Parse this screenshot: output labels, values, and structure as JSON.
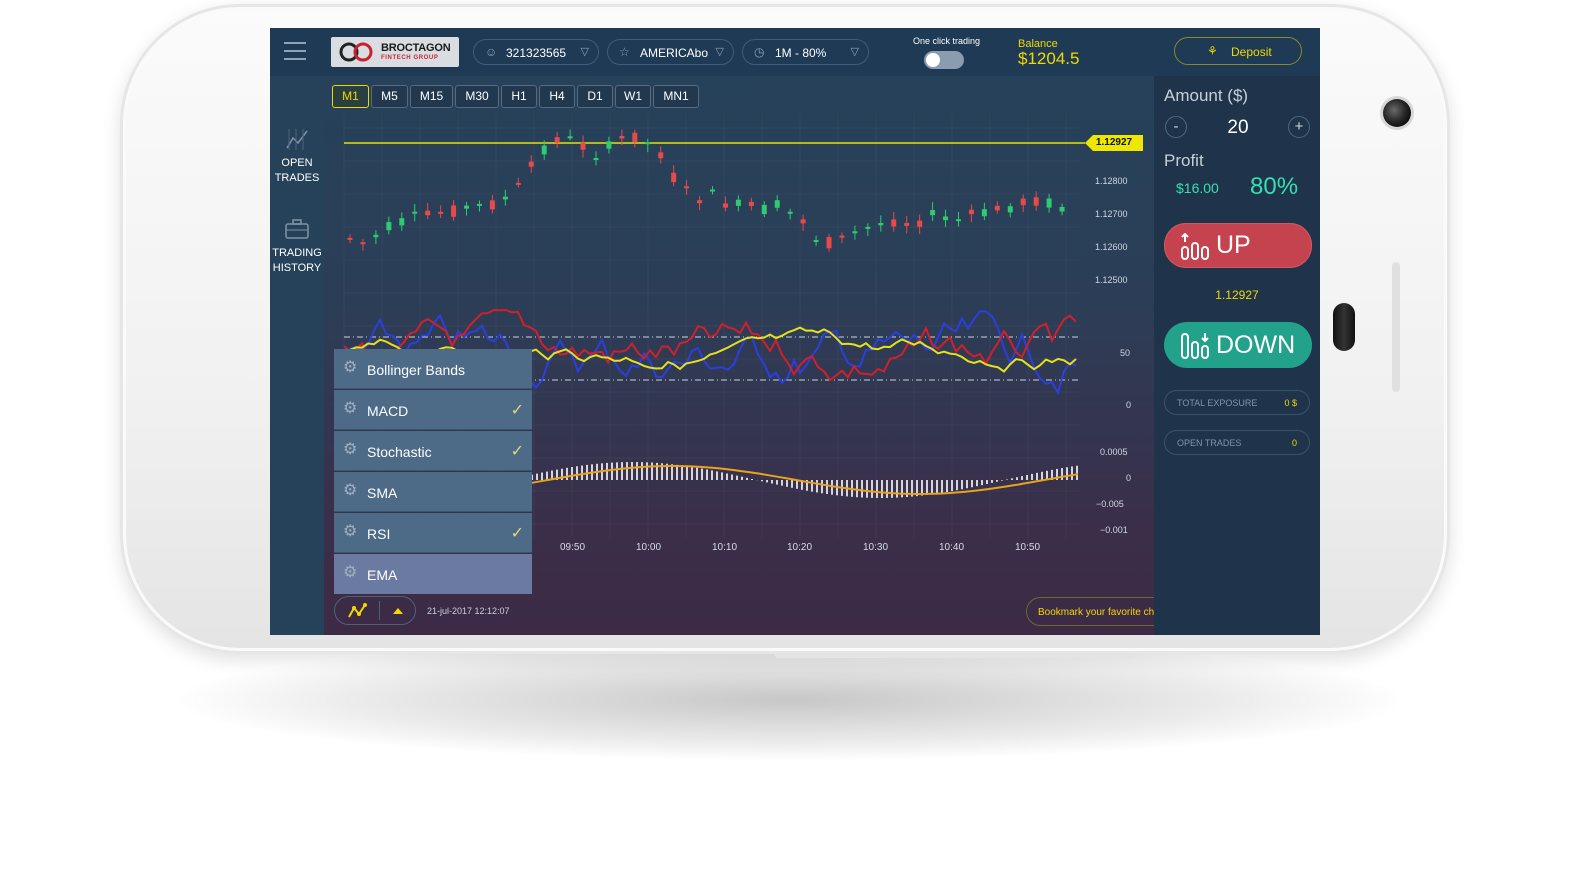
{
  "topbar": {
    "logo": {
      "name": "BROCTAGON",
      "sub": "FINTECH GROUP"
    },
    "account": {
      "icon": "user-icon",
      "value": "321323565"
    },
    "asset": {
      "icon": "star-icon",
      "value": "AMERICAbo"
    },
    "expiry": {
      "icon": "clock-icon",
      "value": "1M - 80%"
    },
    "one_click": {
      "label": "One click trading",
      "enabled": false
    },
    "balance": {
      "label": "Balance",
      "value": "$1204.5"
    },
    "deposit": {
      "label": "Deposit",
      "icon": "money-bag-icon"
    }
  },
  "leftnav": {
    "items": [
      {
        "label_line1": "OPEN",
        "label_line2": "TRADES",
        "icon": "chart-icon"
      },
      {
        "label_line1": "TRADING",
        "label_line2": "HISTORY",
        "icon": "briefcase-icon"
      }
    ]
  },
  "timeframes": [
    {
      "label": "M1",
      "active": true
    },
    {
      "label": "M5",
      "active": false
    },
    {
      "label": "M15",
      "active": false
    },
    {
      "label": "M30",
      "active": false
    },
    {
      "label": "H1",
      "active": false
    },
    {
      "label": "H4",
      "active": false
    },
    {
      "label": "D1",
      "active": false
    },
    {
      "label": "W1",
      "active": false
    },
    {
      "label": "MN1",
      "active": false
    }
  ],
  "chart": {
    "current_price": "1.12927",
    "price_ticks": [
      "1.12800",
      "1.12700",
      "1.12600",
      "1.12500"
    ],
    "stoch_ticks": [
      "50",
      "0"
    ],
    "macd_ticks": [
      "0.0005",
      "0",
      "−0.005",
      "−0.001"
    ],
    "time_ticks": [
      "09:50",
      "10:00",
      "10:10",
      "10:20",
      "10:30",
      "10:40",
      "10:50"
    ]
  },
  "indicators": [
    {
      "label": "Bollinger Bands",
      "checked": false
    },
    {
      "label": "MACD",
      "checked": true
    },
    {
      "label": "Stochastic",
      "checked": true
    },
    {
      "label": "SMA",
      "checked": false
    },
    {
      "label": "RSI",
      "checked": true
    },
    {
      "label": "EMA",
      "checked": false
    }
  ],
  "bottombar": {
    "datetime": "21-jul-2017 12:12:07",
    "bookmark_label": "Bookmark your favorite charts here"
  },
  "panel": {
    "amount_label": "Amount  ($)",
    "amount_value": "20",
    "minus": "-",
    "plus": "+",
    "profit_label": "Profit",
    "profit_value": "$16.00",
    "profit_pct": "80%",
    "up_label": "UP",
    "mid_price": "1.12927",
    "down_label": "DOWN",
    "total_exposure_label": "TOTAL EXPOSURE",
    "total_exposure_value": "0 $",
    "open_trades_label": "OPEN TRADES",
    "open_trades_value": "0"
  },
  "colors": {
    "accent_yellow": "#f1d800",
    "up_red": "#c5434e",
    "down_green": "#22a28b",
    "candle_up": "#2ecc71",
    "candle_down": "#e84a4a"
  }
}
